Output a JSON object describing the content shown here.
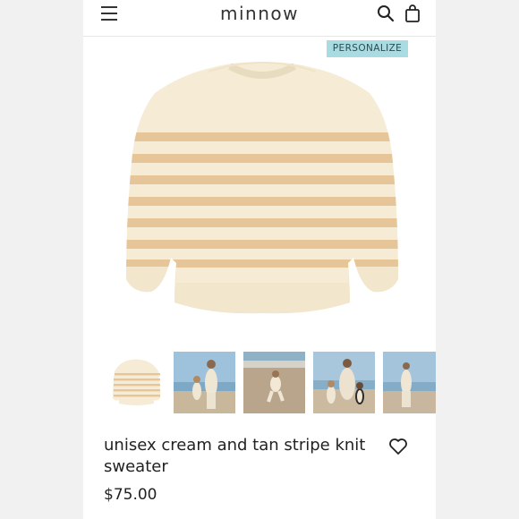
{
  "header": {
    "brand": "minnow",
    "menu_icon": "hamburger-menu-icon",
    "search_icon": "search-icon",
    "bag_icon": "shopping-bag-icon"
  },
  "badge": {
    "label": "PERSONALIZE",
    "color": "#a9dbe2"
  },
  "product": {
    "title": "unisex cream and tan stripe knit sweater",
    "price": "$75.00",
    "wishlist_icon": "heart-icon",
    "main_image": "cream sweater with tan stripes",
    "colors": {
      "cream": "#f6ecd6",
      "stripe": "#e6c698"
    }
  },
  "thumbnails": [
    {
      "alt": "sweater"
    },
    {
      "alt": "mother and child on beach"
    },
    {
      "alt": "child running on beach"
    },
    {
      "alt": "family group on beach"
    },
    {
      "alt": "person walking on beach"
    }
  ]
}
